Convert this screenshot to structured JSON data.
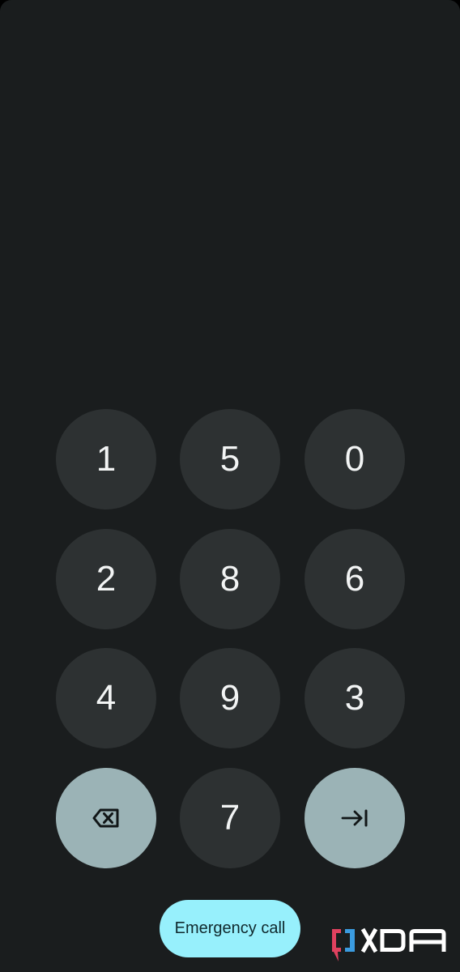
{
  "screen": {
    "type": "PIN pad (scrambled)",
    "background_color": "#1a1d1e"
  },
  "keypad": {
    "rows": [
      [
        {
          "label": "1"
        },
        {
          "label": "5"
        },
        {
          "label": "0"
        }
      ],
      [
        {
          "label": "2"
        },
        {
          "label": "8"
        },
        {
          "label": "6"
        }
      ],
      [
        {
          "label": "4"
        },
        {
          "label": "9"
        },
        {
          "label": "3"
        }
      ],
      [
        {
          "label": "",
          "icon": "backspace-icon"
        },
        {
          "label": "7"
        },
        {
          "label": "",
          "icon": "enter-icon"
        }
      ]
    ],
    "key_color": "#2d3132",
    "accent_key_color": "#9bb3b6",
    "digit_color": "#f2f4f4"
  },
  "emergency_call": {
    "label": "Emergency call",
    "color": "#97f0fc"
  },
  "watermark": {
    "text": "XDA",
    "bracket_left_color": "#e0415f",
    "bracket_right_color": "#3a9be0"
  }
}
